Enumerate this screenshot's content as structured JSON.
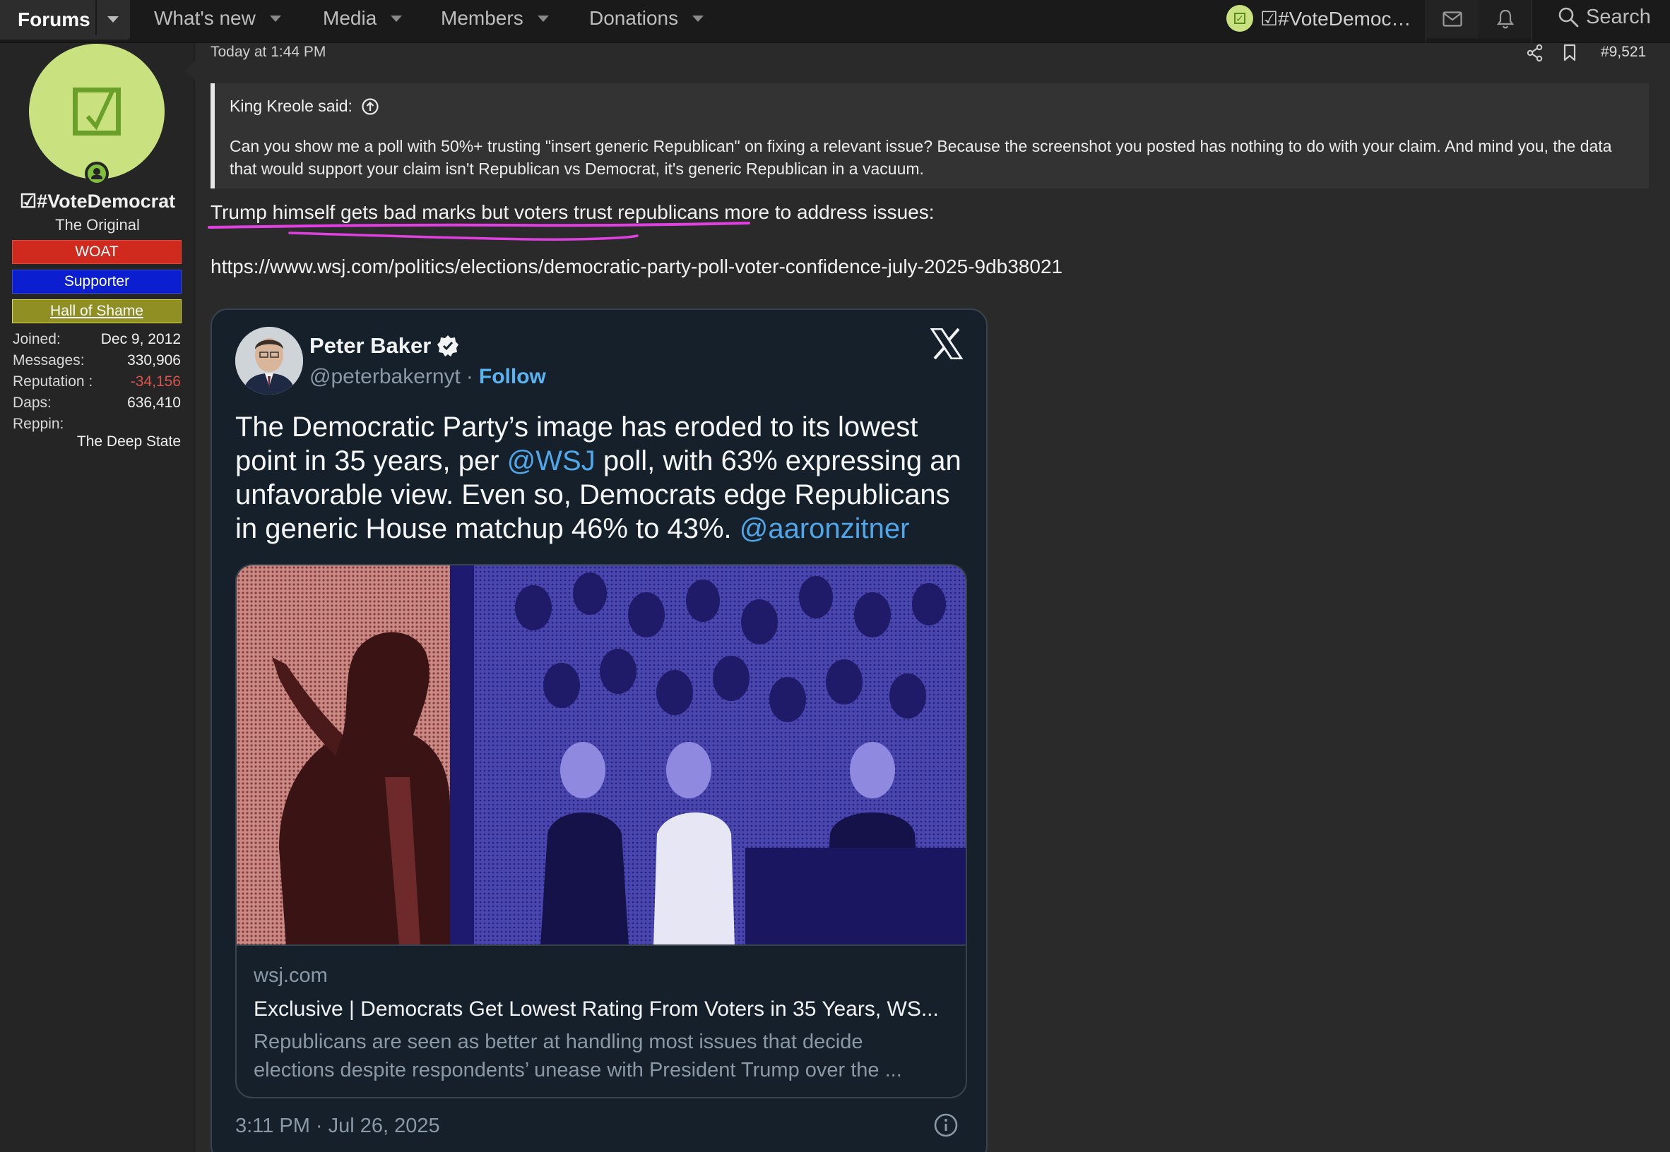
{
  "nav": {
    "forums": "Forums",
    "whats_new": "What's new",
    "media": "Media",
    "members": "Members",
    "donations": "Donations",
    "user_label": "☑#VoteDemoc…",
    "search": "Search"
  },
  "user": {
    "name": "☑#VoteDemocrat",
    "title": "The Original",
    "banners": [
      "WOAT",
      "Supporter",
      "Hall of Shame"
    ],
    "stats": [
      {
        "label": "Joined:",
        "value": "Dec 9, 2012"
      },
      {
        "label": "Messages:",
        "value": "330,906"
      },
      {
        "label": "Reputation :",
        "value": "-34,156"
      },
      {
        "label": "Daps:",
        "value": "636,410"
      },
      {
        "label": "Reppin:",
        "value": ""
      }
    ],
    "reppin_value": "The Deep State",
    "colors": {
      "avatar_bg": "#c9e27f",
      "reputation_negative": "#d9534f",
      "woat": "#cf2a1d",
      "supporter": "#0b1fd0",
      "shame": "#8f8f23"
    }
  },
  "post": {
    "date": "Today at 1:44 PM",
    "number": "#9,521",
    "quote_author": "King Kreole said:",
    "quote_text": "Can you show me a poll with 50%+ trusting \"insert generic Republican\" on fixing a relevant issue? Because the screenshot you posted has nothing to do with your claim. And mind you, the data that would support your claim isn't Republican vs Democrat, it's generic Republican in a vacuum.",
    "line1": "Trump himself gets bad marks but voters trust republicans more to address issues:",
    "link": "https://www.wsj.com/politics/elections/democratic-party-poll-voter-confidence-july-2025-9db38021",
    "highlight_color": "#e040e0"
  },
  "tweet": {
    "name": "Peter Baker",
    "handle": "@peterbakernyt",
    "dot": "·",
    "follow": "Follow",
    "text_parts": [
      "The Democratic Party’s image has eroded to its lowest point in 35 years, per ",
      "@WSJ",
      " poll, with 63% expressing an unfavorable view. Even so, Democrats edge Republicans in generic House matchup 46% to 43%. ",
      "@aaronzitner"
    ],
    "card_domain": "wsj.com",
    "card_title": "Exclusive | Democrats Get Lowest Rating From Voters in 35 Years, WS...",
    "card_desc_1": "Republicans are seen as better at handling most issues that decide",
    "card_desc_2": "elections despite respondents’ unease with President Trump over the ...",
    "time": "3:11 PM · Jul 26, 2025",
    "colors": {
      "bg": "#15202b",
      "link": "#4fa6e8",
      "muted": "#8b98a5"
    }
  }
}
